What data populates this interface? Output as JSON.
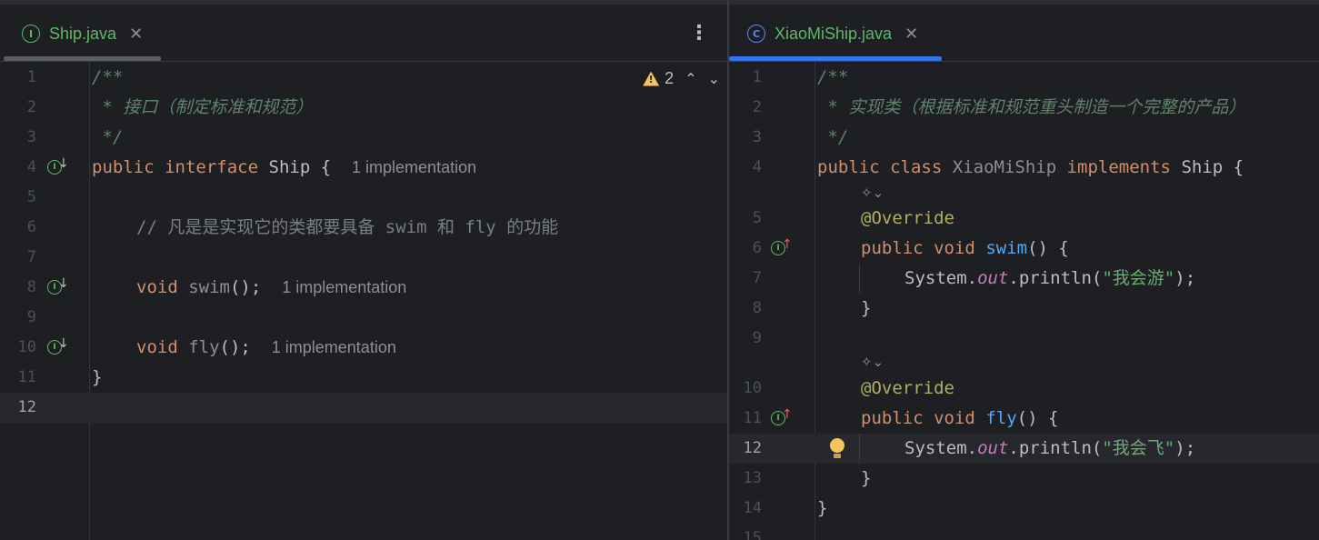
{
  "left": {
    "tab": {
      "name": "Ship.java",
      "icon": "interface-icon",
      "close": "✕"
    },
    "menu": "⋮",
    "warnings": {
      "count": "2",
      "up": "⌃",
      "down": "⌄"
    },
    "gutter_icon_letter": "I",
    "lines": [
      {
        "n": "1"
      },
      {
        "n": "2"
      },
      {
        "n": "3"
      },
      {
        "n": "4"
      },
      {
        "n": "5"
      },
      {
        "n": "6"
      },
      {
        "n": "7"
      },
      {
        "n": "8"
      },
      {
        "n": "9"
      },
      {
        "n": "10"
      },
      {
        "n": "11"
      },
      {
        "n": "12"
      }
    ],
    "code": {
      "l1": "/**",
      "l2": " * 接口（制定标准和规范）",
      "l3": " */",
      "l4_kw1": "public",
      "l4_kw2": "interface",
      "l4_name": "Ship {",
      "l4_hint": "1 implementation",
      "l6_comment_a": "// 凡是是实现它的类都要具备 ",
      "l6_swim": "swim",
      "l6_comment_b": " 和 ",
      "l6_fly": "fly",
      "l6_comment_c": " 的功能",
      "l8_kw": "void",
      "l8_fn": "swim",
      "l8_rest": "();",
      "l8_hint": "1 implementation",
      "l10_kw": "void",
      "l10_fn": "fly",
      "l10_rest": "();",
      "l10_hint": "1 implementation",
      "l11": "}"
    }
  },
  "right": {
    "tab": {
      "name": "XiaoMiShip.java",
      "icon": "class-icon",
      "icon_letter": "C",
      "close": "✕"
    },
    "gutter_icon_letter": "I",
    "code": {
      "l1": "/**",
      "l2": " * 实现类（根据标准和规范重头制造一个完整的产品）",
      "l3": " */",
      "l4_kw1": "public",
      "l4_kw2": "class",
      "l4_name": "XiaoMiShip",
      "l4_kw3": "implements",
      "l4_iface": "Ship {",
      "ai_inlay": "✧⌄",
      "l5_ann": "@Override",
      "l6_kw1": "public",
      "l6_kw2": "void",
      "l6_fn": "swim",
      "l6_rest": "() {",
      "l7_sys": "System.",
      "l7_out": "out",
      "l7_print": ".println(",
      "l7_str": "\"我会游\"",
      "l7_end": ");",
      "l8": "}",
      "l10_ann": "@Override",
      "l11_kw1": "public",
      "l11_kw2": "void",
      "l11_fn": "fly",
      "l11_rest": "() {",
      "l12_sys": "System.",
      "l12_out": "out",
      "l12_print": ".println(",
      "l12_str": "\"我会飞\"",
      "l12_end": ");",
      "l13": "}",
      "l14": "}"
    },
    "line_numbers": [
      "1",
      "2",
      "3",
      "4",
      "5",
      "6",
      "7",
      "8",
      "9",
      "10",
      "11",
      "12",
      "13",
      "14",
      "15"
    ]
  },
  "colors": {
    "background": "#1e1f22",
    "keyword": "#cf8e6d",
    "function": "#56a8f5",
    "annotation": "#b3ae60",
    "string": "#6aab73",
    "doc_comment": "#5f826b",
    "tab_active_underline": "#3574f0"
  }
}
